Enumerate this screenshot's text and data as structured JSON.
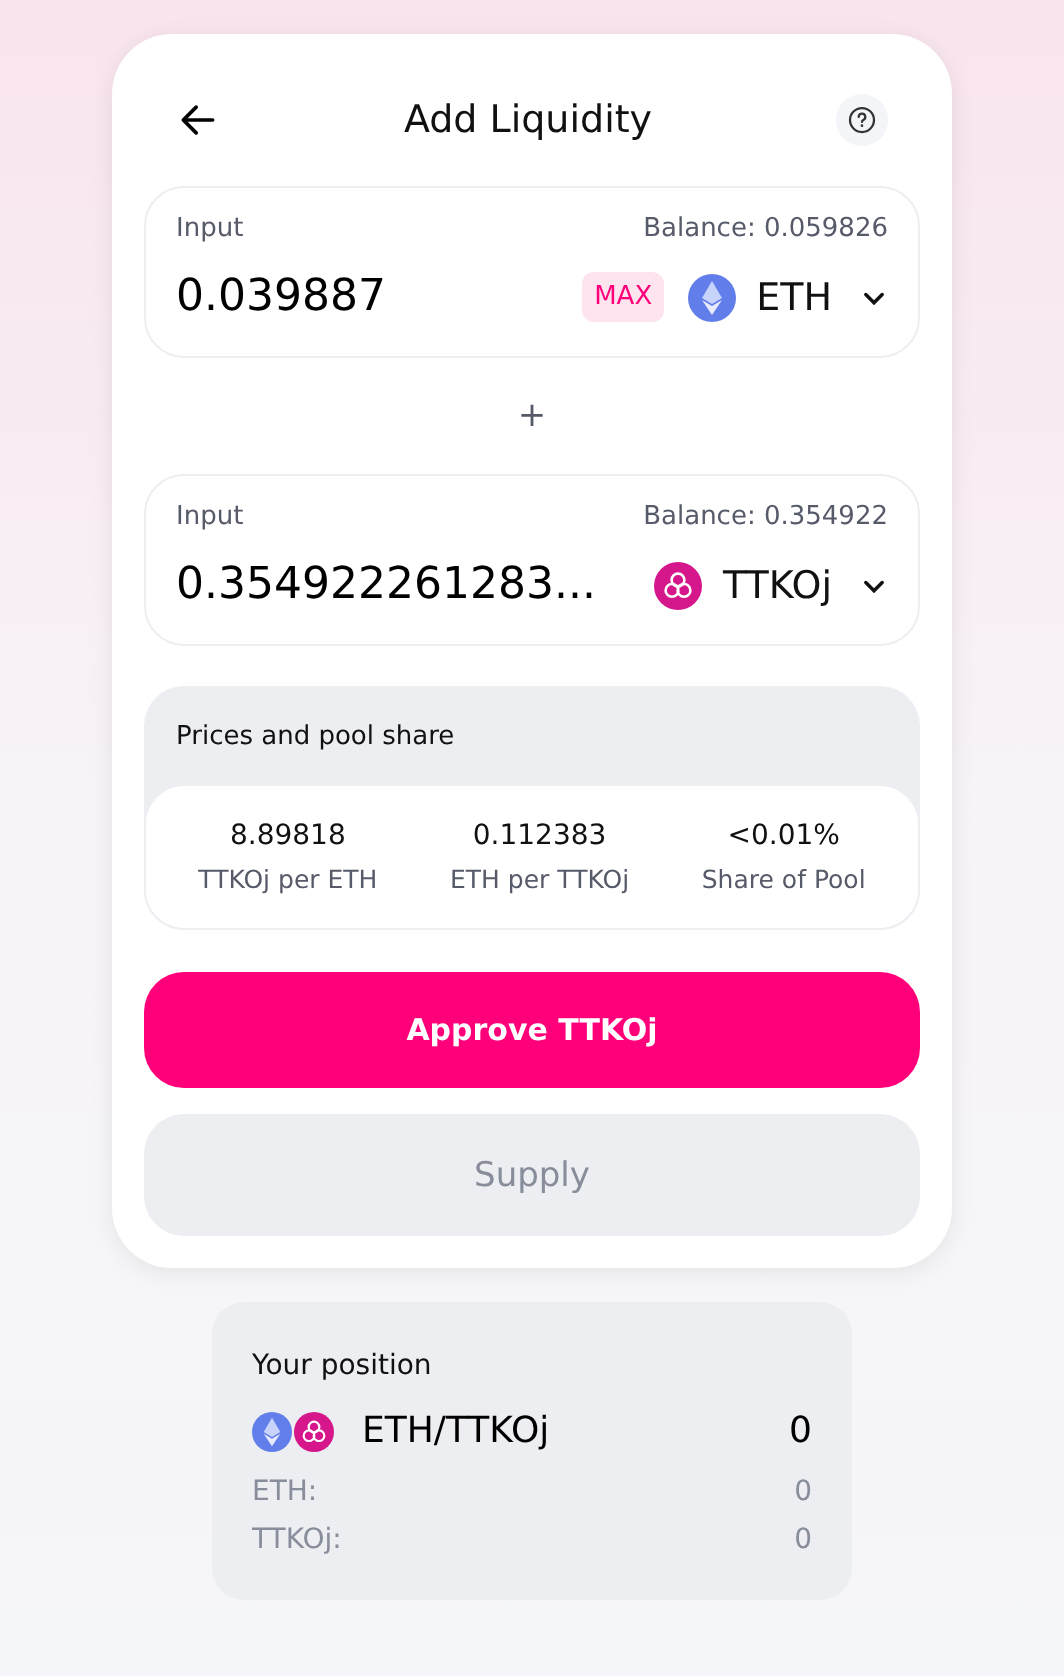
{
  "header": {
    "title": "Add Liquidity"
  },
  "inputs": [
    {
      "label": "Input",
      "balance": "Balance: 0.059826",
      "value": "0.039887",
      "max": "MAX",
      "token": "ETH",
      "kind": "eth"
    },
    {
      "label": "Input",
      "balance": "Balance: 0.354922",
      "value": "0.354922261283...",
      "token": "TTKOj",
      "kind": "ttkoj"
    }
  ],
  "separator": "+",
  "prices": {
    "title": "Prices and pool share",
    "items": [
      {
        "value": "8.89818",
        "label": "TTKOj per ETH"
      },
      {
        "value": "0.112383",
        "label": "ETH per TTKOj"
      },
      {
        "value": "<0.01%",
        "label": "Share of Pool"
      }
    ]
  },
  "buttons": [
    {
      "label": "Approve TTKOj",
      "disabled": false
    },
    {
      "label": "Supply",
      "disabled": true
    }
  ],
  "position": {
    "title": "Your position",
    "pair": "ETH/TTKOj",
    "pair_amount": "0",
    "rows": [
      {
        "label": "ETH:",
        "value": "0"
      },
      {
        "label": "TTKOj:",
        "value": "0"
      }
    ]
  }
}
